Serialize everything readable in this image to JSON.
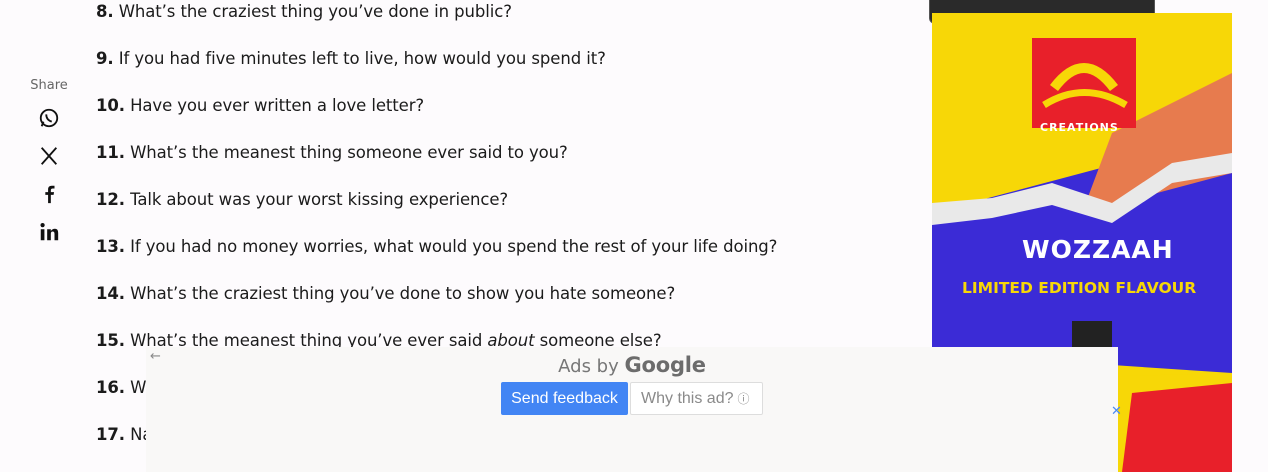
{
  "share": {
    "label": "Share",
    "icons": [
      "whatsapp-icon",
      "x-icon",
      "facebook-icon",
      "linkedin-icon"
    ]
  },
  "questions": [
    {
      "num": "8.",
      "pre": " What’s the craziest thing you’ve done in public?",
      "em": "",
      "post": ""
    },
    {
      "num": "9.",
      "pre": " If you had five minutes left to live, how would you spend it?",
      "em": "",
      "post": ""
    },
    {
      "num": "10.",
      "pre": " Have you ever written a love letter?",
      "em": "",
      "post": ""
    },
    {
      "num": "11.",
      "pre": " What’s the meanest thing someone ever said to you?",
      "em": "",
      "post": ""
    },
    {
      "num": "12.",
      "pre": " Talk about was your worst kissing experience?",
      "em": "",
      "post": ""
    },
    {
      "num": "13.",
      "pre": " If you had no money worries, what would you spend the rest of your life doing?",
      "em": "",
      "post": ""
    },
    {
      "num": "14.",
      "pre": " What’s the craziest thing you’ve done to show you hate someone?",
      "em": "",
      "post": ""
    },
    {
      "num": "15.",
      "pre": " What’s the meanest thing you’ve ever said ",
      "em": "about",
      "post": " someone else?"
    },
    {
      "num": "16.",
      "pre": " Wh",
      "em": "",
      "post": ""
    },
    {
      "num": "17.",
      "pre": " Nar",
      "em": "",
      "post": ""
    }
  ],
  "ad_right": {
    "brand": "CREATIONS",
    "headline": "WOZZAAH",
    "subline": "LIMITED EDITION FLAVOUR"
  },
  "ads_overlay": {
    "ads_by": "Ads by",
    "google": "Google",
    "send_feedback": "Send feedback",
    "why_this_ad": "Why this ad?",
    "close": "✕"
  },
  "colors": {
    "feedback_blue": "#4285f4",
    "ad_yellow": "#f7d707",
    "ad_blue": "#3b2bd6",
    "ad_red": "#e8202a"
  }
}
